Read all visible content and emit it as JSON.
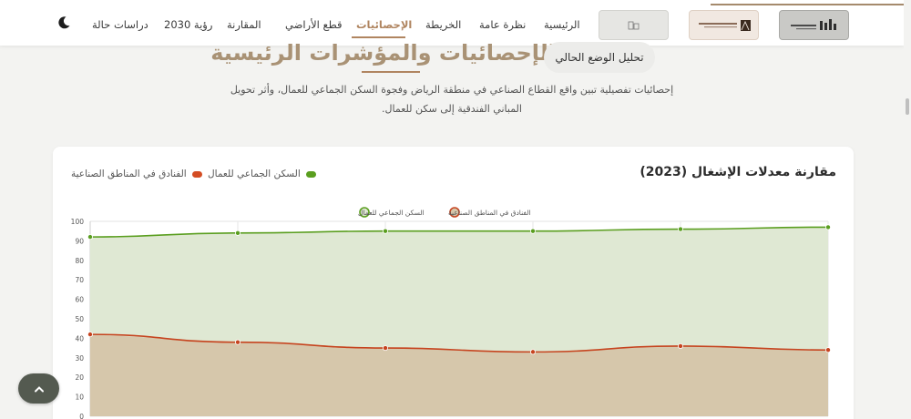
{
  "nav": {
    "items": [
      {
        "label": "الرئيسية",
        "active": false
      },
      {
        "label": "نظرة عامة",
        "active": false
      },
      {
        "label": "الخريطة",
        "active": false
      },
      {
        "label": "الإحصائيات",
        "active": true
      },
      {
        "label": "قطع الأراضي",
        "active": false
      },
      {
        "label": "المقارنة",
        "active": false
      },
      {
        "label": "رؤية 2030",
        "active": false
      },
      {
        "label": "دراسات حالة",
        "active": false
      }
    ],
    "theme_icon": "moon-icon",
    "accent_color": "#b08560"
  },
  "hero": {
    "badge": "تحليل الوضع الحالي",
    "title": "الإحصائيات والمؤشرات الرئيسية",
    "subtitle_line1": "إحصائيات تفصيلية تبين واقع القطاع الصناعي في منطقة الرياض وفجوة السكن الجماعي للعمال، وأثر تحويل",
    "subtitle_line2": "المباني الفندقية إلى سكن للعمال."
  },
  "card": {
    "title": "مقارنة معدلات الإشغال (2023)",
    "legend": [
      {
        "label": "السكن الجماعي للعمال",
        "color": "#5a9e1f"
      },
      {
        "label": "الفنادق في المناطق الصناعية",
        "color": "#d44d24"
      }
    ]
  },
  "chart_data": {
    "type": "area",
    "title": "",
    "legend": [
      "السكن الجماعي للعمال",
      "الفنادق في المناطق الصناعية"
    ],
    "y_ticks": [
      "100",
      "90",
      "80",
      "70",
      "60",
      "50",
      "40",
      "30",
      "20",
      "10",
      "0"
    ],
    "ylim": [
      0,
      100
    ],
    "grid": true,
    "legend_placement": "top-center",
    "series": [
      {
        "name": "السكن الجماعي للعمال",
        "color": "#5a9e1f",
        "fill": "#dfe8d3",
        "values": [
          92,
          94,
          95,
          95,
          96,
          97
        ]
      },
      {
        "name": "الفنادق في المناطق الصناعية",
        "color": "#c6441f",
        "fill": "#d6c7ab",
        "values": [
          42,
          38,
          35,
          33,
          36,
          34
        ]
      }
    ]
  },
  "back_to_top_icon": "chevron-up-icon"
}
